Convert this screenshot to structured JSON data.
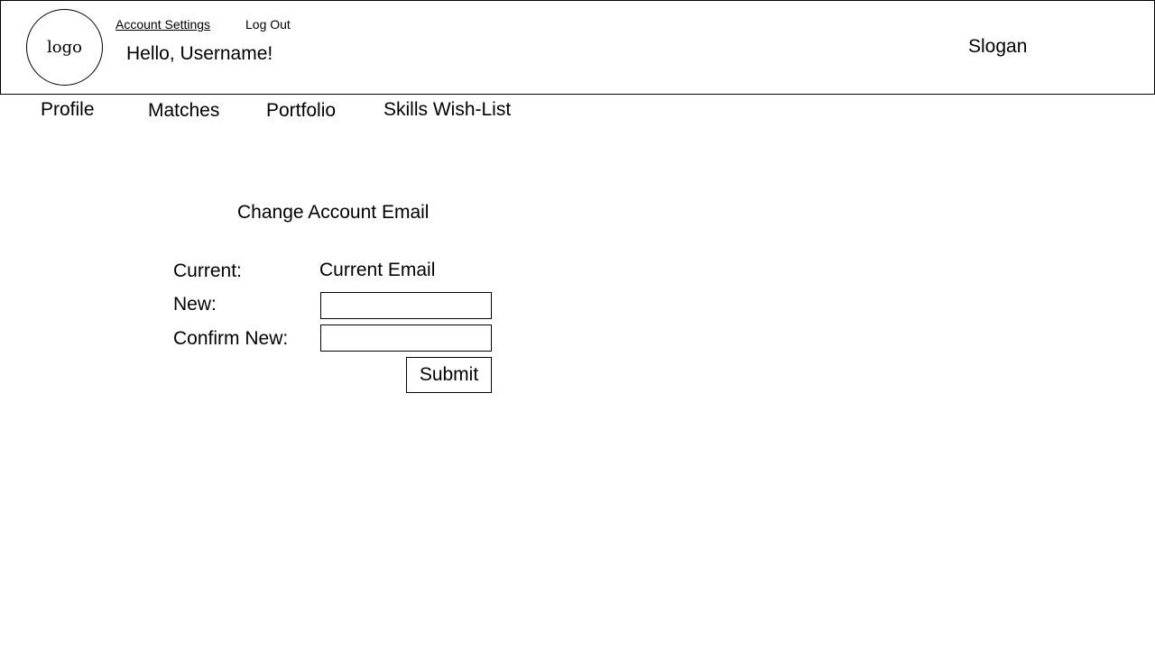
{
  "header": {
    "logo_text": "logo",
    "links": {
      "account_settings": "Account Settings",
      "log_out": "Log Out"
    },
    "greeting": "Hello, Username!",
    "slogan": "Slogan"
  },
  "nav": {
    "profile": "Profile",
    "matches": "Matches",
    "portfolio": "Portfolio",
    "skills_wishlist": "Skills Wish-List"
  },
  "form": {
    "title": "Change Account Email",
    "current_label": "Current:",
    "current_value": "Current Email",
    "new_label": "New:",
    "new_value": "",
    "confirm_label": "Confirm New:",
    "confirm_value": "",
    "submit_label": "Submit"
  },
  "colors": {
    "background": "#ffffff",
    "border": "#000000",
    "text": "#000000"
  }
}
